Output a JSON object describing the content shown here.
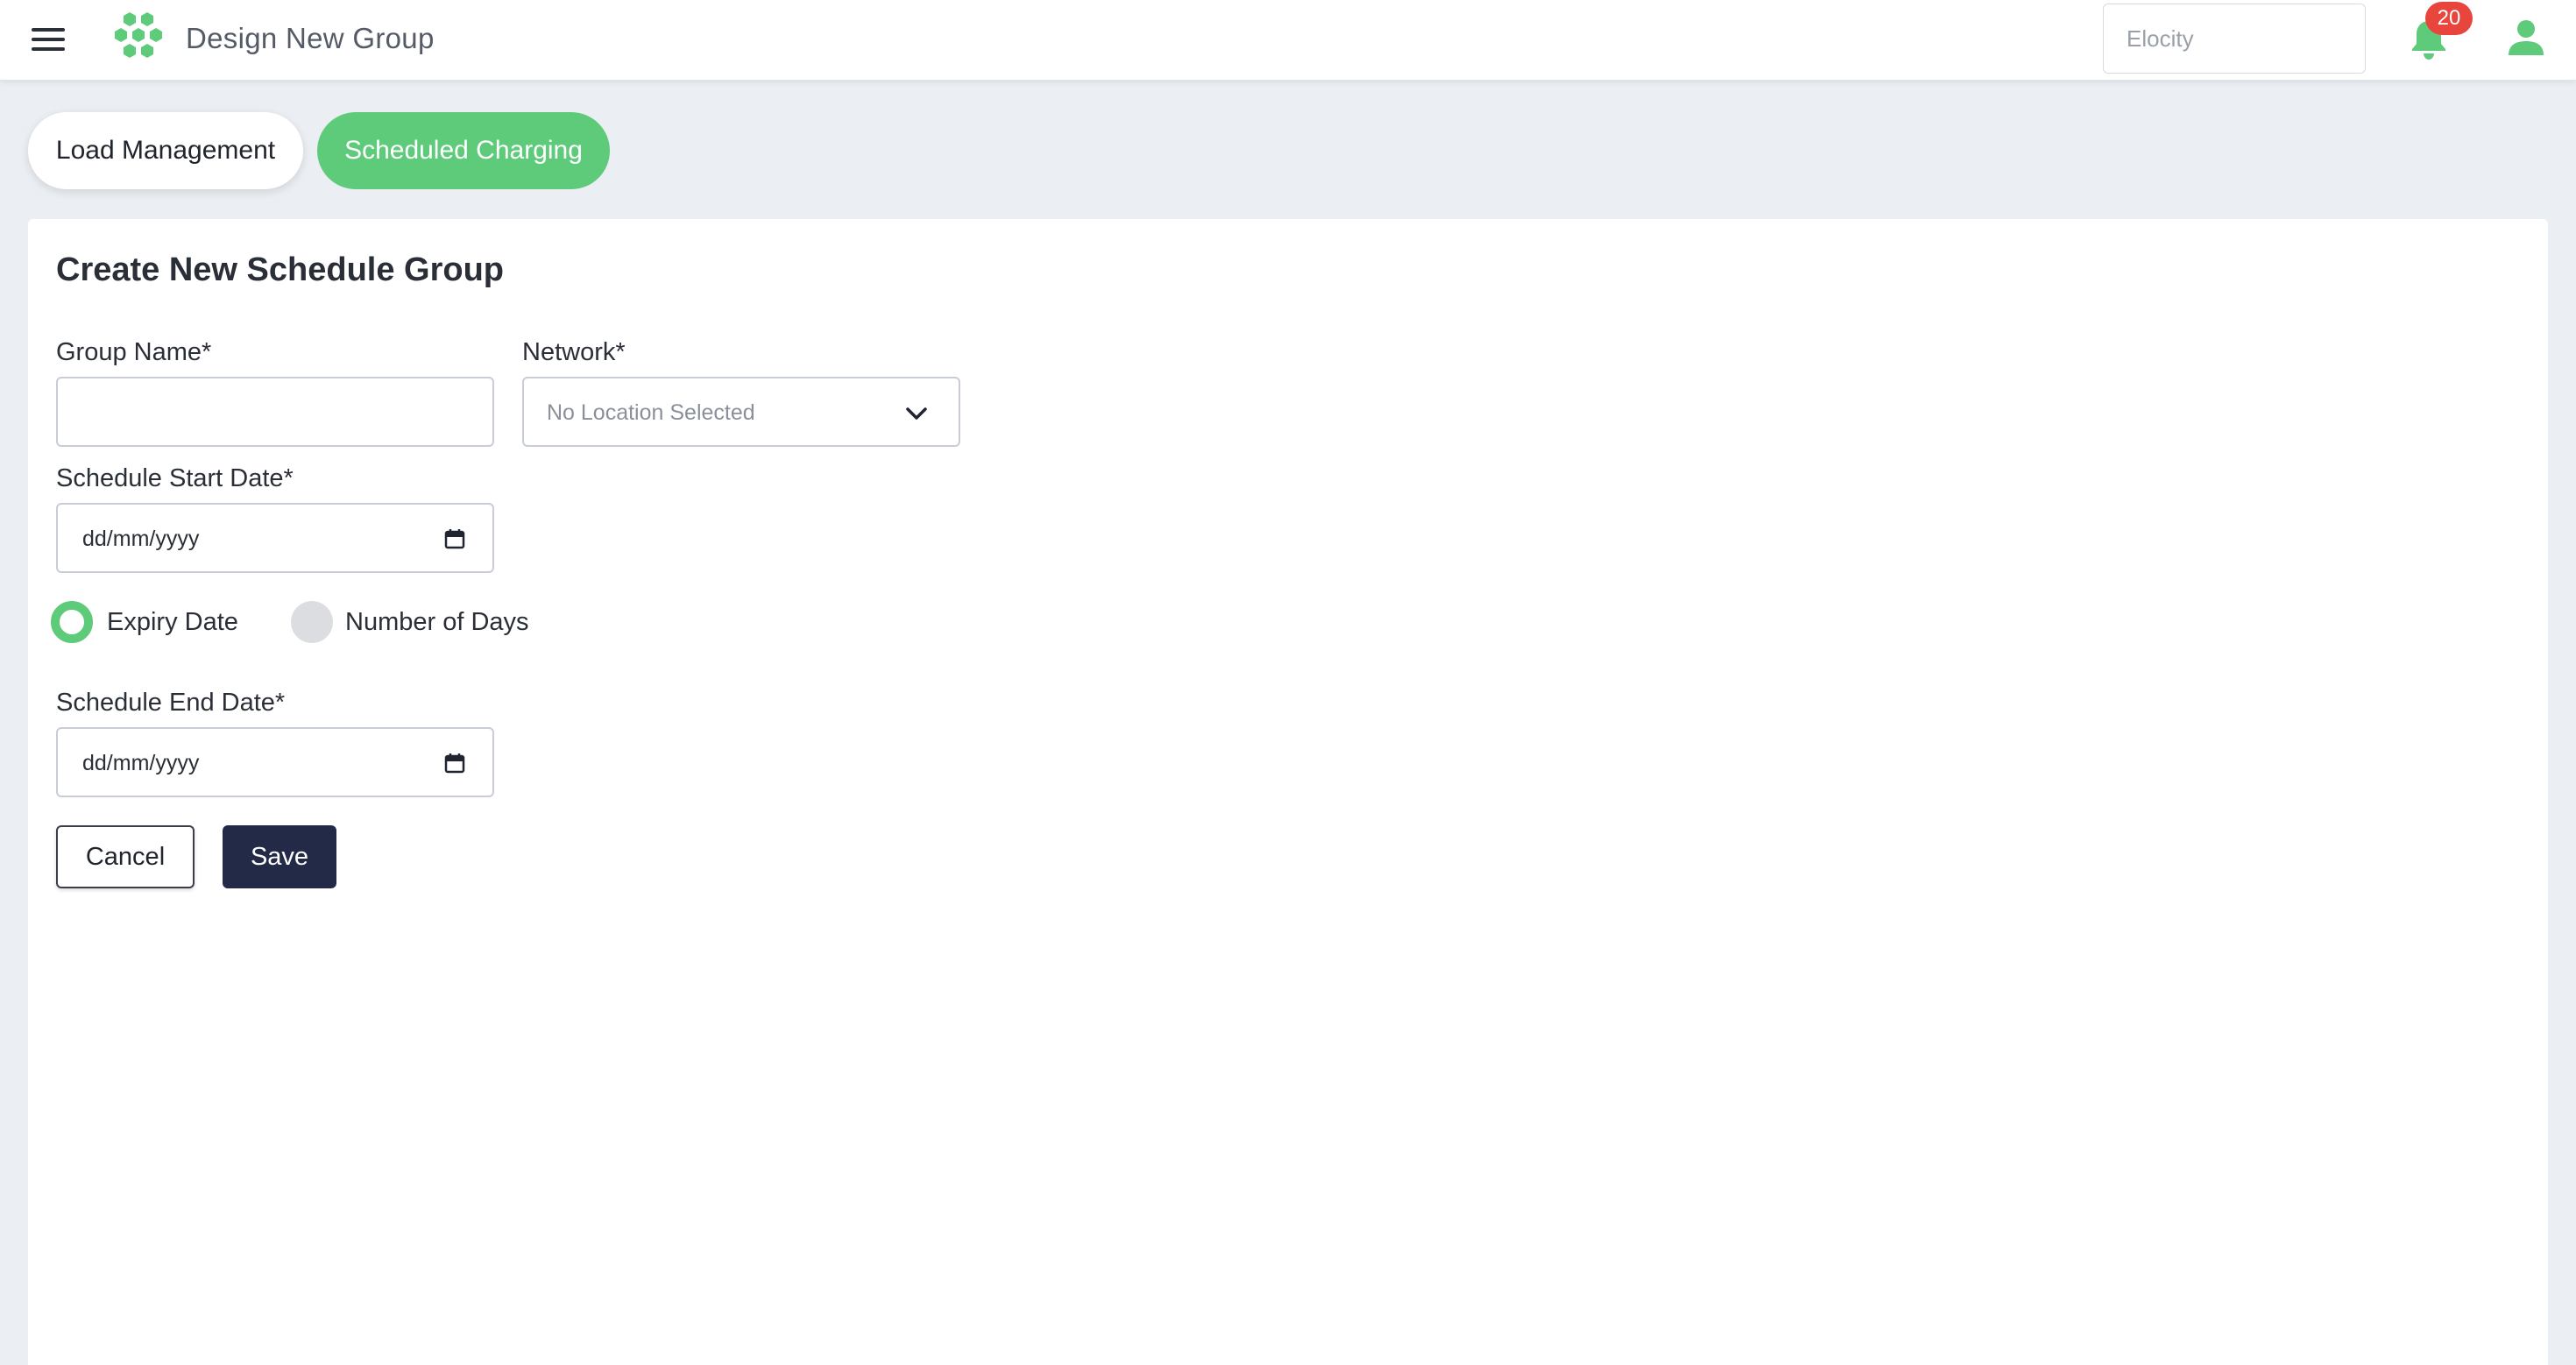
{
  "header": {
    "title": "Design New Group",
    "search_placeholder": "Elocity",
    "notification_count": "20",
    "icons": [
      "menu-icon",
      "hexagon-logo",
      "bell-icon",
      "user-icon"
    ]
  },
  "tabs": [
    {
      "label": "Load Management",
      "active": false
    },
    {
      "label": "Scheduled Charging",
      "active": true
    }
  ],
  "form": {
    "title": "Create New Schedule Group",
    "group_name_label": "Group Name*",
    "group_name_value": "",
    "network_label": "Network*",
    "network_value": "No Location Selected",
    "start_date_label": "Schedule Start Date*",
    "start_date_value": "dd/mm/yyyy",
    "radio_expiry_label": "Expiry Date",
    "radio_days_label": "Number of Days",
    "selected_radio": "Expiry Date",
    "end_date_label": "Schedule End Date*",
    "end_date_value": "dd/mm/yyyy",
    "cancel_label": "Cancel",
    "save_label": "Save"
  },
  "colors": {
    "accent_green": "#5ecb7b",
    "primary_navy": "#232a47",
    "badge_red": "#e8453c",
    "page_background": "#ebeef3"
  }
}
